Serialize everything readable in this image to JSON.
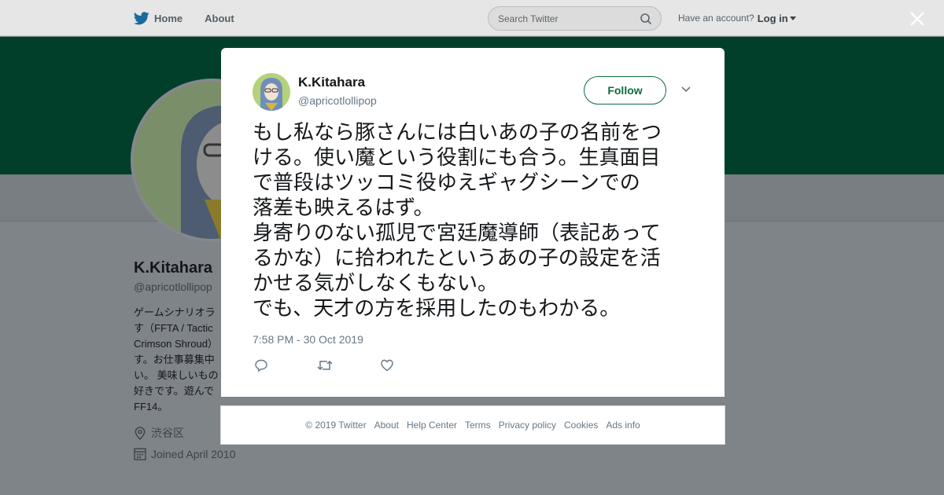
{
  "topbar": {
    "home_label": "Home",
    "about_label": "About",
    "search_placeholder": "Search Twitter",
    "have_account": "Have an account?",
    "login_label": "Log in"
  },
  "profile": {
    "name": "K.Kitahara",
    "handle": "@apricotlollipop",
    "bio_lines": [
      "ゲームシナリオラ",
      "す（FFTA / Tactic",
      "Crimson Shroud）",
      "す。お仕事募集中",
      "い。 美味しいもの",
      "好きです。遊んで",
      "FF14。"
    ],
    "location": "渋谷区",
    "joined": "Joined April 2010"
  },
  "tweet": {
    "name": "K.Kitahara",
    "handle": "@apricotlollipop",
    "follow_label": "Follow",
    "text_lines": [
      "もし私なら豚さんには白いあの子の名前をつ",
      "ける。使い魔という役割にも合う。生真面目",
      "で普段はツッコミ役ゆえギャグシーンでの",
      "落差も映えるはず。",
      "身寄りのない孤児で宮廷魔導師（表記あって",
      "るかな）に拾われたというあの子の設定を活",
      "かせる気がしなくもない。",
      "でも、天才の方を採用したのもわかる。"
    ],
    "timestamp": "7:58 PM - 30 Oct 2019"
  },
  "footer": {
    "links": [
      "© 2019 Twitter",
      "About",
      "Help Center",
      "Terms",
      "Privacy policy",
      "Cookies",
      "Ads info"
    ]
  },
  "colors": {
    "brand_green": "#0f6b3e",
    "banner": "#023f2a",
    "twitter_blue": "#1da1f2"
  }
}
